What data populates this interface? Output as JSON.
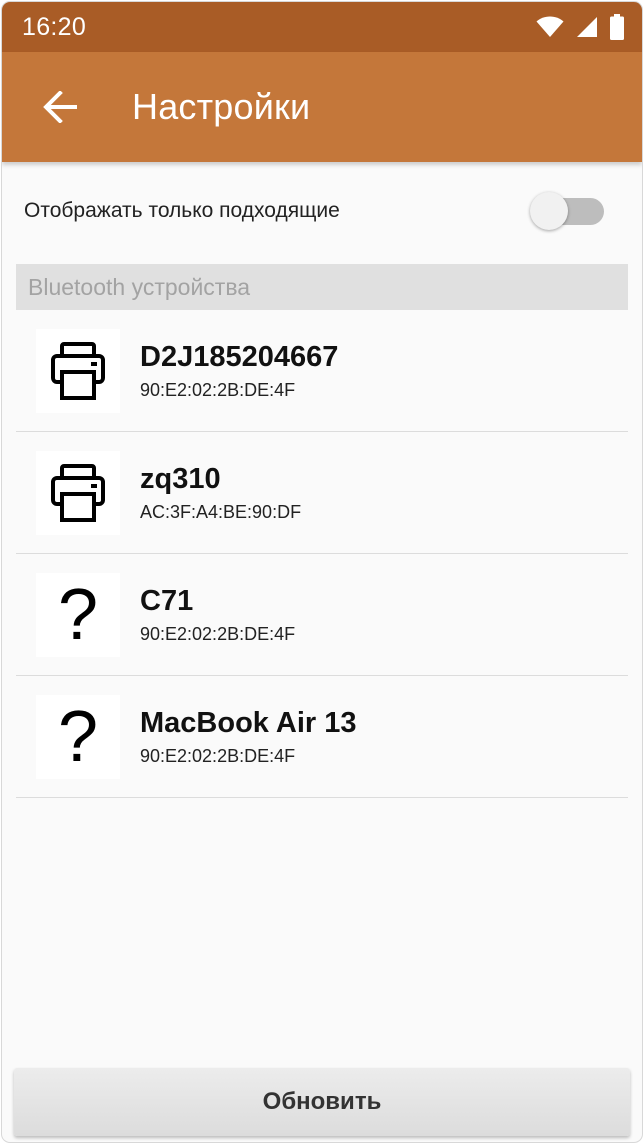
{
  "status_bar": {
    "time": "16:20",
    "icons": [
      "wifi-icon",
      "cellular-signal-icon",
      "battery-icon"
    ]
  },
  "app_bar": {
    "title": "Настройки",
    "back_icon": "arrow-back-icon"
  },
  "filter": {
    "label": "Отображать только подходящие",
    "enabled": false
  },
  "section": {
    "title": "Bluetooth устройства"
  },
  "devices": [
    {
      "name": "D2J185204667",
      "mac": "90:E2:02:2B:DE:4F",
      "icon": "printer-icon"
    },
    {
      "name": "zq310",
      "mac": "AC:3F:A4:BE:90:DF",
      "icon": "printer-icon"
    },
    {
      "name": "C71",
      "mac": "90:E2:02:2B:DE:4F",
      "icon": "question-mark-icon",
      "icon_glyph": "?"
    },
    {
      "name": "MacBook Air 13",
      "mac": "90:E2:02:2B:DE:4F",
      "icon": "question-mark-icon",
      "icon_glyph": "?"
    }
  ],
  "refresh_button": {
    "label": "Обновить"
  },
  "colors": {
    "status_bar": "#a95c26",
    "app_bar": "#c4773a",
    "background": "#fafafa",
    "section_header": "#e0e0e0"
  }
}
